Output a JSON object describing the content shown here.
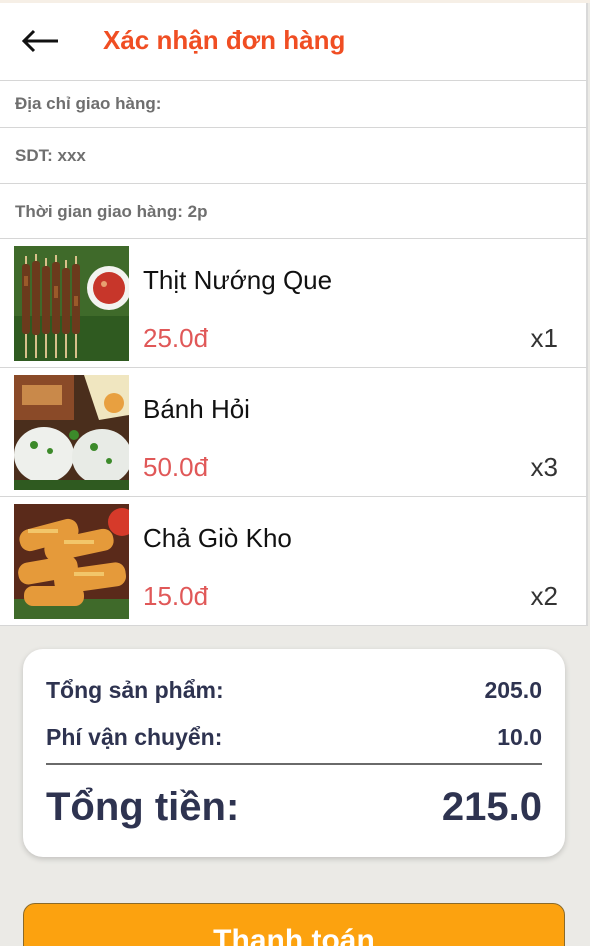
{
  "header": {
    "back_icon": "arrow-left-icon",
    "title": "Xác nhận đơn hàng"
  },
  "info": {
    "address_label": "Địa chỉ giao hàng:",
    "phone_label": "SDT: xxx",
    "delivery_time_label": "Thời gian giao hàng: 2p"
  },
  "items": [
    {
      "name": "Thịt Nướng Que",
      "price": "25.0đ",
      "qty": "x1",
      "image": "grilled-pork-skewers"
    },
    {
      "name": "Bánh Hỏi",
      "price": "50.0đ",
      "qty": "x3",
      "image": "banh-hoi-rice-vermicelli"
    },
    {
      "name": "Chả Giò Kho",
      "price": "15.0đ",
      "qty": "x2",
      "image": "spring-rolls"
    }
  ],
  "summary": {
    "subtotal_label": "Tổng sản phẩm:",
    "subtotal_value": "205.0",
    "shipping_label": "Phí vận chuyển:",
    "shipping_value": "10.0",
    "total_label": "Tổng tiền:",
    "total_value": "215.0"
  },
  "pay_button": {
    "label": "Thanh toán"
  },
  "colors": {
    "accent": "#f04e23",
    "price": "#e05858",
    "summary_text": "#2e3350",
    "button": "#fca20f",
    "background": "#ebeae6"
  }
}
